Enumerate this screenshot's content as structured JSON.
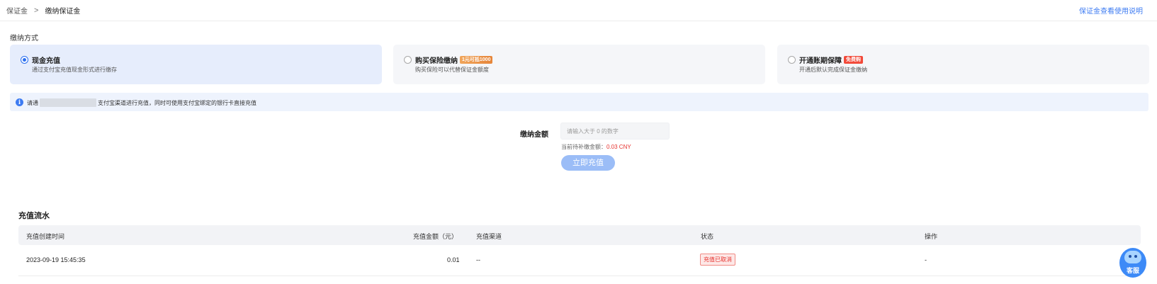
{
  "breadcrumb": {
    "root": "保证金",
    "separator": ">",
    "current": "缴纳保证金"
  },
  "help_link": "保证金查看使用说明",
  "payment_section_label": "缴纳方式",
  "payment_options": [
    {
      "title": "现金充值",
      "desc": "通过支付宝充值现金形式进行缴存",
      "tag": "",
      "selected": true
    },
    {
      "title": "购买保险缴纳",
      "desc": "购买保险可以代替保证金额度",
      "tag": "1元可抵1000",
      "selected": false
    },
    {
      "title": "开通账期保障",
      "desc": "开通后默认完成保证金缴纳",
      "tag": "免费购",
      "selected": false
    }
  ],
  "info_notice": {
    "prefix": "请通",
    "suffix": "支付宝渠道进行充值，同时可使用支付宝绑定的银行卡直接充值"
  },
  "form": {
    "amount_label": "缴纳金额",
    "amount_placeholder": "请输入大于 0 的数字",
    "due_label": "当前待补缴金额：",
    "due_value": "0.03 CNY",
    "submit_label": "立即充值"
  },
  "records": {
    "title": "充值流水",
    "columns": [
      "充值创建时间",
      "充值金额（元）",
      "充值渠道",
      "状态",
      "操作"
    ],
    "rows": [
      {
        "created_at": "2023-09-19 15:45:35",
        "amount": "0.01",
        "channel": "--",
        "status": "充值已取消",
        "action": "-"
      }
    ]
  },
  "customer_service_label": "客服",
  "colors": {
    "accent": "#3d7bf2",
    "selected_bg": "#e6edfc",
    "error_red": "#e6322e",
    "button_disabled": "#9bbdf7"
  }
}
